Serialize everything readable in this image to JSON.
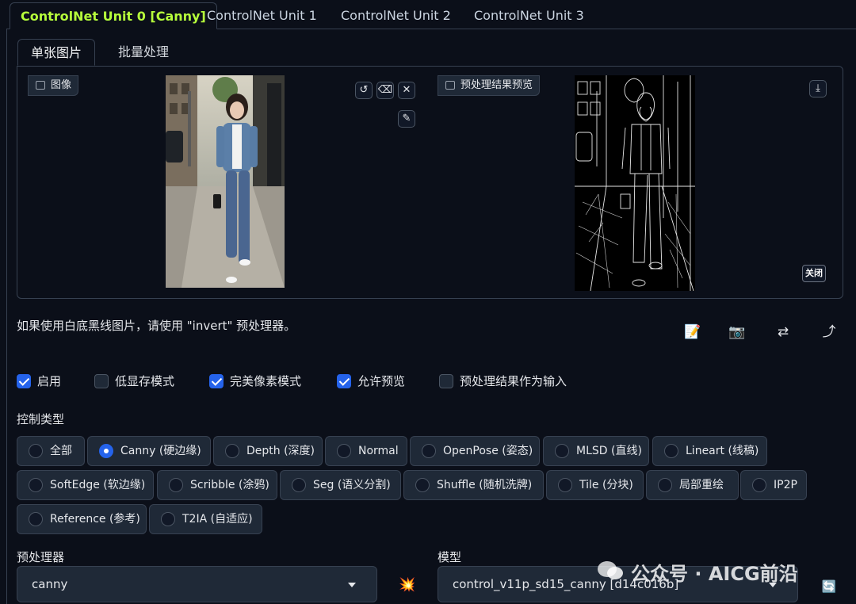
{
  "unit_tabs": [
    "ControlNet Unit 0 [Canny]",
    "ControlNet Unit 1",
    "ControlNet Unit 2",
    "ControlNet Unit 3"
  ],
  "sub_tabs": [
    "单张图片",
    "批量处理"
  ],
  "image_input": {
    "label": "图像",
    "icon": "image-icon"
  },
  "preview": {
    "label": "预处理结果预览",
    "icon": "image-icon",
    "close_label": "关闭"
  },
  "image_tools": {
    "undo": "↺",
    "eraser": "⌫",
    "clear": "✕",
    "brush": "✎",
    "download": "⤓"
  },
  "hint": "如果使用白底黑线图片，请使用 \"invert\" 预处理器。",
  "toolbar_icons": [
    "📝",
    "📷",
    "⇄",
    "⤴"
  ],
  "options": [
    {
      "label": "启用",
      "checked": true
    },
    {
      "label": "低显存模式",
      "checked": false
    },
    {
      "label": "完美像素模式",
      "checked": true
    },
    {
      "label": "允许预览",
      "checked": true
    },
    {
      "label": "预处理结果作为输入",
      "checked": false
    }
  ],
  "control_type_label": "控制类型",
  "control_types": [
    {
      "label": "全部",
      "selected": false
    },
    {
      "label": "Canny (硬边缘)",
      "selected": true
    },
    {
      "label": "Depth (深度)",
      "selected": false
    },
    {
      "label": "Normal",
      "selected": false
    },
    {
      "label": "OpenPose (姿态)",
      "selected": false
    },
    {
      "label": "MLSD (直线)",
      "selected": false
    },
    {
      "label": "Lineart (线稿)",
      "selected": false
    },
    {
      "label": "SoftEdge (软边缘)",
      "selected": false
    },
    {
      "label": "Scribble (涂鸦)",
      "selected": false
    },
    {
      "label": "Seg (语义分割)",
      "selected": false
    },
    {
      "label": "Shuffle (随机洗牌)",
      "selected": false
    },
    {
      "label": "Tile (分块)",
      "selected": false
    },
    {
      "label": "局部重绘",
      "selected": false
    },
    {
      "label": "IP2P",
      "selected": false
    },
    {
      "label": "Reference (参考)",
      "selected": false
    },
    {
      "label": "T2IA (自适应)",
      "selected": false
    }
  ],
  "preprocessor": {
    "label": "预处理器",
    "value": "canny",
    "run_icon": "💥"
  },
  "model": {
    "label": "模型",
    "value": "control_v11p_sd15_canny [d14c016b]",
    "refresh_icon": "🔄"
  },
  "watermark": "公众号 · AICG前沿",
  "colors": {
    "accent_tab": "#b6ff3b",
    "checkbox_on": "#2563eb",
    "background": "#0b0f19",
    "surface": "#1f2937",
    "border": "#374151"
  }
}
